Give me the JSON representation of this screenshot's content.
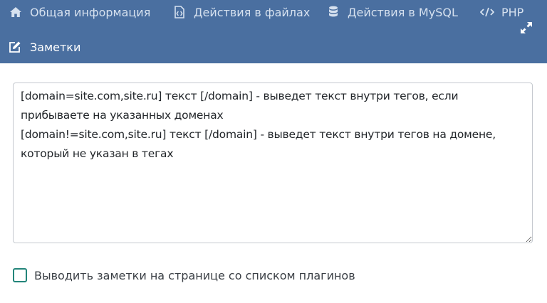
{
  "header": {
    "tabs": [
      {
        "label": "Общая информация",
        "icon": "home-icon"
      },
      {
        "label": "Действия в файлах",
        "icon": "file-code-icon"
      },
      {
        "label": "Действия в MySQL",
        "icon": "database-icon"
      },
      {
        "label": "PHP",
        "icon": "code-icon"
      }
    ],
    "expand_icon": "expand-icon",
    "notes_title": "Заметки",
    "notes_icon": "edit-icon"
  },
  "notes": {
    "text": "[domain=site.com,site.ru] текст [/domain] - выведет текст внутри тегов, если прибываете на указанных доменах\n[domain!=site.com,site.ru] текст [/domain] - выведет текст внутри тегов на домене, который не указан в тегах"
  },
  "show_notes_checkbox": {
    "label": "Выводить заметки на странице со списком плагинов",
    "checked": false
  },
  "colors": {
    "header_bg": "#4a6fa0",
    "tab_text": "#d6e1ef",
    "checkbox_border": "#23857a"
  }
}
